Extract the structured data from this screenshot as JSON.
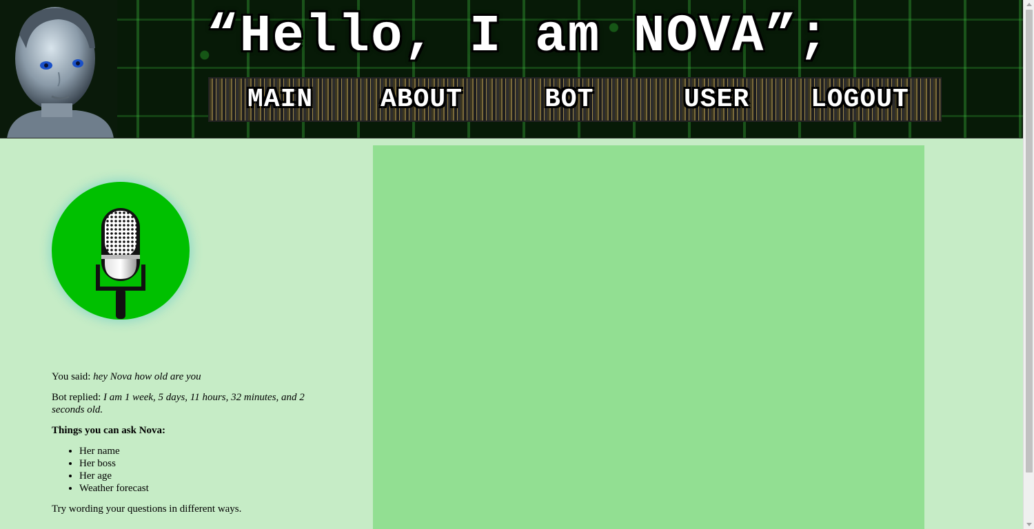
{
  "header": {
    "title": "“Hello, I am NOVA”;",
    "robot_icon": "robot-face-icon"
  },
  "nav": {
    "items": [
      {
        "label": "MAIN"
      },
      {
        "label": "ABOUT"
      },
      {
        "label": "BOT"
      },
      {
        "label": "USER"
      },
      {
        "label": "LOGOUT"
      }
    ]
  },
  "mic": {
    "icon": "microphone-icon",
    "color": "#00c000"
  },
  "conversation": {
    "you_said_label": "You said:",
    "you_said_text": "hey Nova how old are you",
    "bot_replied_label": "Bot replied:",
    "bot_replied_text": "I am 1 week, 5 days, 11 hours, 32 minutes, and 2 seconds old.",
    "things_heading": "Things you can ask Nova:",
    "things": [
      "Her name",
      "Her boss",
      "Her age",
      "Weather forecast"
    ],
    "footer_text": "Try wording your questions in different ways."
  },
  "colors": {
    "page_background": "#c6ecc6",
    "panel_background": "#92df92",
    "header_background": "#071a07"
  }
}
